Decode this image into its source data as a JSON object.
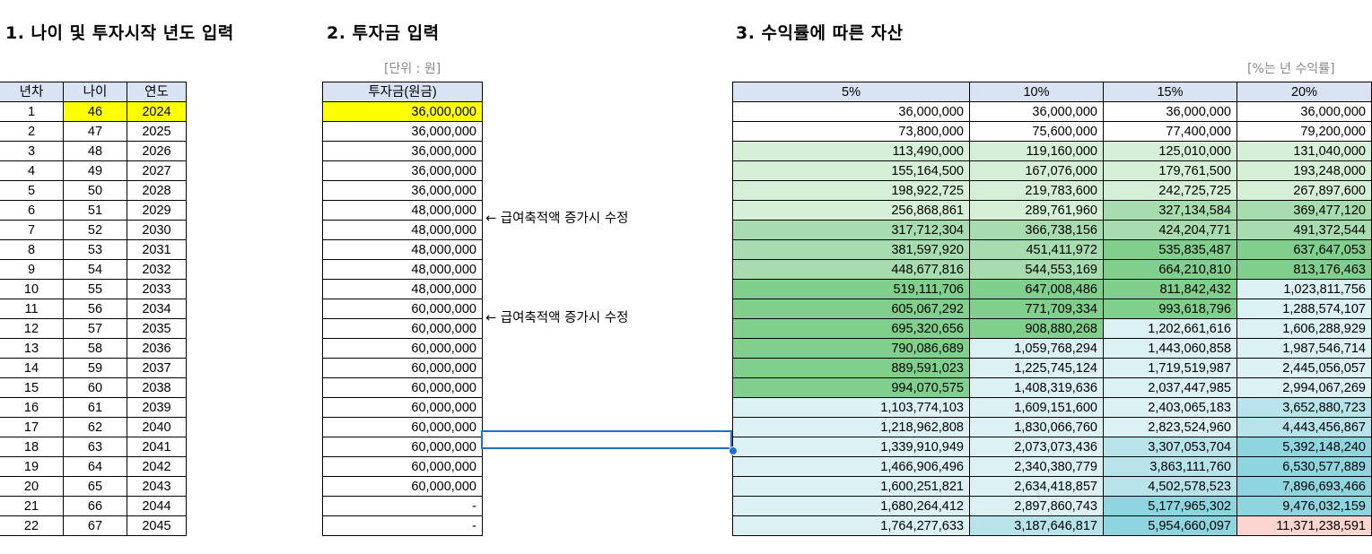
{
  "headings": {
    "s1": "1. 나이 및 투자시작 년도 입력",
    "s2": "2. 투자금 입력",
    "s3": "3. 수익률에 따른 자산"
  },
  "unit_label": "[단위 : 원]",
  "rate_label": "[%는 년 수익률]",
  "notes": [
    "← 급여축적액 증가시 수정",
    "← 급여축적액 증가시 수정"
  ],
  "table1": {
    "headers": [
      "년차",
      "나이",
      "연도"
    ],
    "rows": [
      [
        "1",
        "46",
        "2024"
      ],
      [
        "2",
        "47",
        "2025"
      ],
      [
        "3",
        "48",
        "2026"
      ],
      [
        "4",
        "49",
        "2027"
      ],
      [
        "5",
        "50",
        "2028"
      ],
      [
        "6",
        "51",
        "2029"
      ],
      [
        "7",
        "52",
        "2030"
      ],
      [
        "8",
        "53",
        "2031"
      ],
      [
        "9",
        "54",
        "2032"
      ],
      [
        "10",
        "55",
        "2033"
      ],
      [
        "11",
        "56",
        "2034"
      ],
      [
        "12",
        "57",
        "2035"
      ],
      [
        "13",
        "58",
        "2036"
      ],
      [
        "14",
        "59",
        "2037"
      ],
      [
        "15",
        "60",
        "2038"
      ],
      [
        "16",
        "61",
        "2039"
      ],
      [
        "17",
        "62",
        "2040"
      ],
      [
        "18",
        "63",
        "2041"
      ],
      [
        "19",
        "64",
        "2042"
      ],
      [
        "20",
        "65",
        "2043"
      ],
      [
        "21",
        "66",
        "2044"
      ],
      [
        "22",
        "67",
        "2045"
      ]
    ]
  },
  "table2": {
    "header": "투자금(원금)",
    "rows": [
      "36,000,000",
      "36,000,000",
      "36,000,000",
      "36,000,000",
      "36,000,000",
      "48,000,000",
      "48,000,000",
      "48,000,000",
      "48,000,000",
      "48,000,000",
      "60,000,000",
      "60,000,000",
      "60,000,000",
      "60,000,000",
      "60,000,000",
      "60,000,000",
      "60,000,000",
      "60,000,000",
      "60,000,000",
      "60,000,000",
      "-",
      "-"
    ]
  },
  "table3": {
    "headers": [
      "5%",
      "10%",
      "15%",
      "20%"
    ],
    "rows": [
      [
        "36,000,000",
        "36,000,000",
        "36,000,000",
        "36,000,000"
      ],
      [
        "73,800,000",
        "75,600,000",
        "77,400,000",
        "79,200,000"
      ],
      [
        "113,490,000",
        "119,160,000",
        "125,010,000",
        "131,040,000"
      ],
      [
        "155,164,500",
        "167,076,000",
        "179,761,500",
        "193,248,000"
      ],
      [
        "198,922,725",
        "219,783,600",
        "242,725,725",
        "267,897,600"
      ],
      [
        "256,868,861",
        "289,761,960",
        "327,134,584",
        "369,477,120"
      ],
      [
        "317,712,304",
        "366,738,156",
        "424,204,771",
        "491,372,544"
      ],
      [
        "381,597,920",
        "451,411,972",
        "535,835,487",
        "637,647,053"
      ],
      [
        "448,677,816",
        "544,553,169",
        "664,210,810",
        "813,176,463"
      ],
      [
        "519,111,706",
        "647,008,486",
        "811,842,432",
        "1,023,811,756"
      ],
      [
        "605,067,292",
        "771,709,334",
        "993,618,796",
        "1,288,574,107"
      ],
      [
        "695,320,656",
        "908,880,268",
        "1,202,661,616",
        "1,606,288,929"
      ],
      [
        "790,086,689",
        "1,059,768,294",
        "1,443,060,858",
        "1,987,546,714"
      ],
      [
        "889,591,023",
        "1,225,745,124",
        "1,719,519,987",
        "2,445,056,057"
      ],
      [
        "994,070,575",
        "1,408,319,636",
        "2,037,447,985",
        "2,994,067,269"
      ],
      [
        "1,103,774,103",
        "1,609,151,600",
        "2,403,065,183",
        "3,652,880,723"
      ],
      [
        "1,218,962,808",
        "1,830,066,760",
        "2,823,524,960",
        "4,443,456,867"
      ],
      [
        "1,339,910,949",
        "2,073,073,436",
        "3,307,053,704",
        "5,392,148,240"
      ],
      [
        "1,466,906,496",
        "2,340,380,779",
        "3,863,111,760",
        "6,530,577,889"
      ],
      [
        "1,600,251,821",
        "2,634,418,857",
        "4,502,578,523",
        "7,896,693,466"
      ],
      [
        "1,680,264,412",
        "2,897,860,743",
        "5,177,965,302",
        "9,476,032,159"
      ],
      [
        "1,764,277,633",
        "3,187,646,817",
        "5,954,660,097",
        "11,371,238,591"
      ]
    ],
    "fills": [
      [
        "#ffffff",
        "#ffffff",
        "#ffffff",
        "#ffffff"
      ],
      [
        "#ffffff",
        "#ffffff",
        "#ffffff",
        "#ffffff"
      ],
      [
        "#d5f0d7",
        "#d5f0d7",
        "#d5f0d7",
        "#d5f0d7"
      ],
      [
        "#d5f0d7",
        "#d5f0d7",
        "#d5f0d7",
        "#d5f0d7"
      ],
      [
        "#d5f0d7",
        "#d5f0d7",
        "#d5f0d7",
        "#d5f0d7"
      ],
      [
        "#d5f0d7",
        "#d5f0d7",
        "#a6dcae",
        "#a6dcae"
      ],
      [
        "#a6dcae",
        "#a6dcae",
        "#a6dcae",
        "#a6dcae"
      ],
      [
        "#a6dcae",
        "#a6dcae",
        "#80cf8c",
        "#80cf8c"
      ],
      [
        "#a6dcae",
        "#a6dcae",
        "#80cf8c",
        "#80cf8c"
      ],
      [
        "#80cf8c",
        "#80cf8c",
        "#80cf8c",
        "#dbf1f4"
      ],
      [
        "#80cf8c",
        "#80cf8c",
        "#80cf8c",
        "#dbf1f4"
      ],
      [
        "#80cf8c",
        "#80cf8c",
        "#dbf1f4",
        "#dbf1f4"
      ],
      [
        "#80cf8c",
        "#dbf1f4",
        "#dbf1f4",
        "#dbf1f4"
      ],
      [
        "#80cf8c",
        "#dbf1f4",
        "#dbf1f4",
        "#dbf1f4"
      ],
      [
        "#80cf8c",
        "#dbf1f4",
        "#dbf1f4",
        "#dbf1f4"
      ],
      [
        "#dbf1f4",
        "#dbf1f4",
        "#dbf1f4",
        "#b6e4ea"
      ],
      [
        "#dbf1f4",
        "#dbf1f4",
        "#dbf1f4",
        "#b6e4ea"
      ],
      [
        "#dbf1f4",
        "#dbf1f4",
        "#b6e4ea",
        "#8fd5e0"
      ],
      [
        "#dbf1f4",
        "#dbf1f4",
        "#b6e4ea",
        "#8fd5e0"
      ],
      [
        "#dbf1f4",
        "#dbf1f4",
        "#b6e4ea",
        "#8fd5e0"
      ],
      [
        "#dbf1f4",
        "#dbf1f4",
        "#8fd5e0",
        "#8fd5e0"
      ],
      [
        "#dbf1f4",
        "#b6e4ea",
        "#8fd5e0",
        "#fcd5d0"
      ]
    ]
  },
  "colors": {
    "header_fill": "#dae3f3",
    "input_highlight": "#ffff00",
    "selection_border": "#1f6fd2"
  }
}
